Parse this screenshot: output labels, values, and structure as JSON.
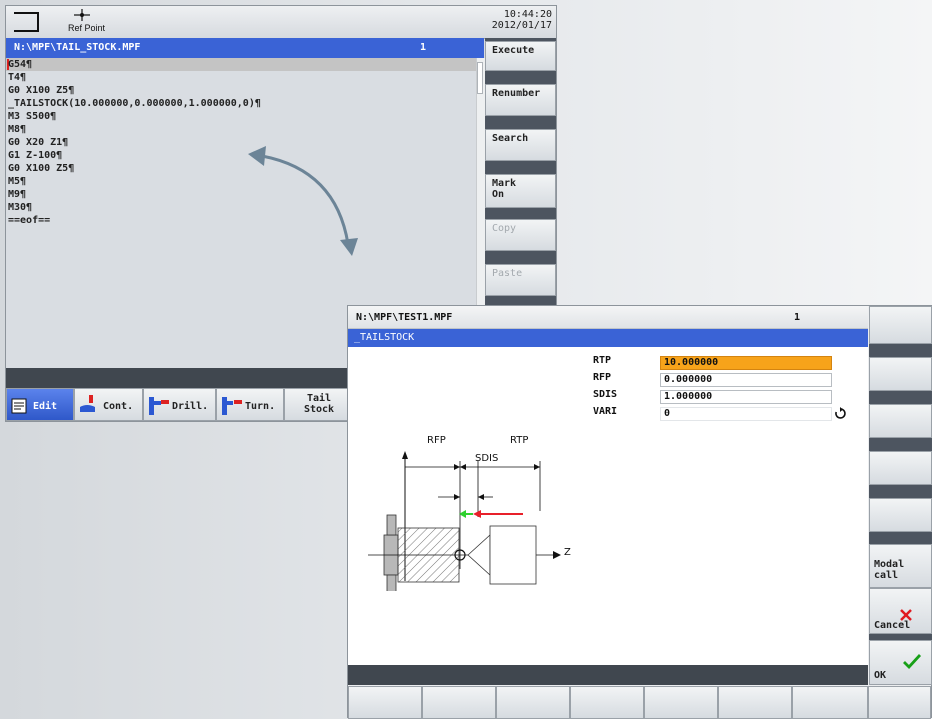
{
  "panel1": {
    "header": {
      "refpoint_label": "Ref Point",
      "time": "10:44:20",
      "date": "2012/01/17"
    },
    "title": {
      "path": "N:\\MPF\\TAIL_STOCK.MPF",
      "channel": "1"
    },
    "code_lines": [
      "G54¶",
      "T4¶",
      "G0 X100 Z5¶",
      "_TAILSTOCK(10.000000,0.000000,1.000000,0)¶",
      "M3 S500¶",
      "M8¶",
      "G0 X20 Z1¶",
      "G1 Z-100¶",
      "G0 X100 Z5¶",
      "M5¶",
      "M9¶",
      "M30¶",
      "==eof=="
    ],
    "vertical_softkeys": {
      "execute": "Execute",
      "renumber": "Renumber",
      "search": "Search",
      "mark_on_line1": "Mark",
      "mark_on_line2": "On",
      "copy": "Copy",
      "paste": "Paste"
    },
    "horizontal_softkeys": {
      "edit": "Edit",
      "cont": "Cont.",
      "drill": "Drill.",
      "turn": "Turn.",
      "tailstock_line1": "Tail",
      "tailstock_line2": "Stock"
    }
  },
  "panel2": {
    "title": {
      "path": "N:\\MPF\\TEST1.MPF",
      "channel": "1"
    },
    "cycle_name": "_TAILSTOCK",
    "params": [
      {
        "label": "RTP",
        "value": "10.000000"
      },
      {
        "label": "RFP",
        "value": "0.000000"
      },
      {
        "label": "SDIS",
        "value": "1.000000"
      },
      {
        "label": "VARI",
        "value": "0"
      }
    ],
    "diagram": {
      "rfp": "RFP",
      "rtp": "RTP",
      "sdis": "SDIS",
      "axis_z": "Z"
    },
    "vertical_softkeys": {
      "modal_line1": "Modal",
      "modal_line2": "call",
      "cancel": "Cancel",
      "ok": "OK"
    }
  },
  "colors": {
    "title_blue": "#3a63d6",
    "focus_orange": "#f7a31a",
    "arrow_red": "#e8202a",
    "arrow_green": "#2fd12f",
    "ok_green": "#18a018",
    "cancel_red": "#e0191f",
    "curved_arrow": "#6c8497"
  }
}
